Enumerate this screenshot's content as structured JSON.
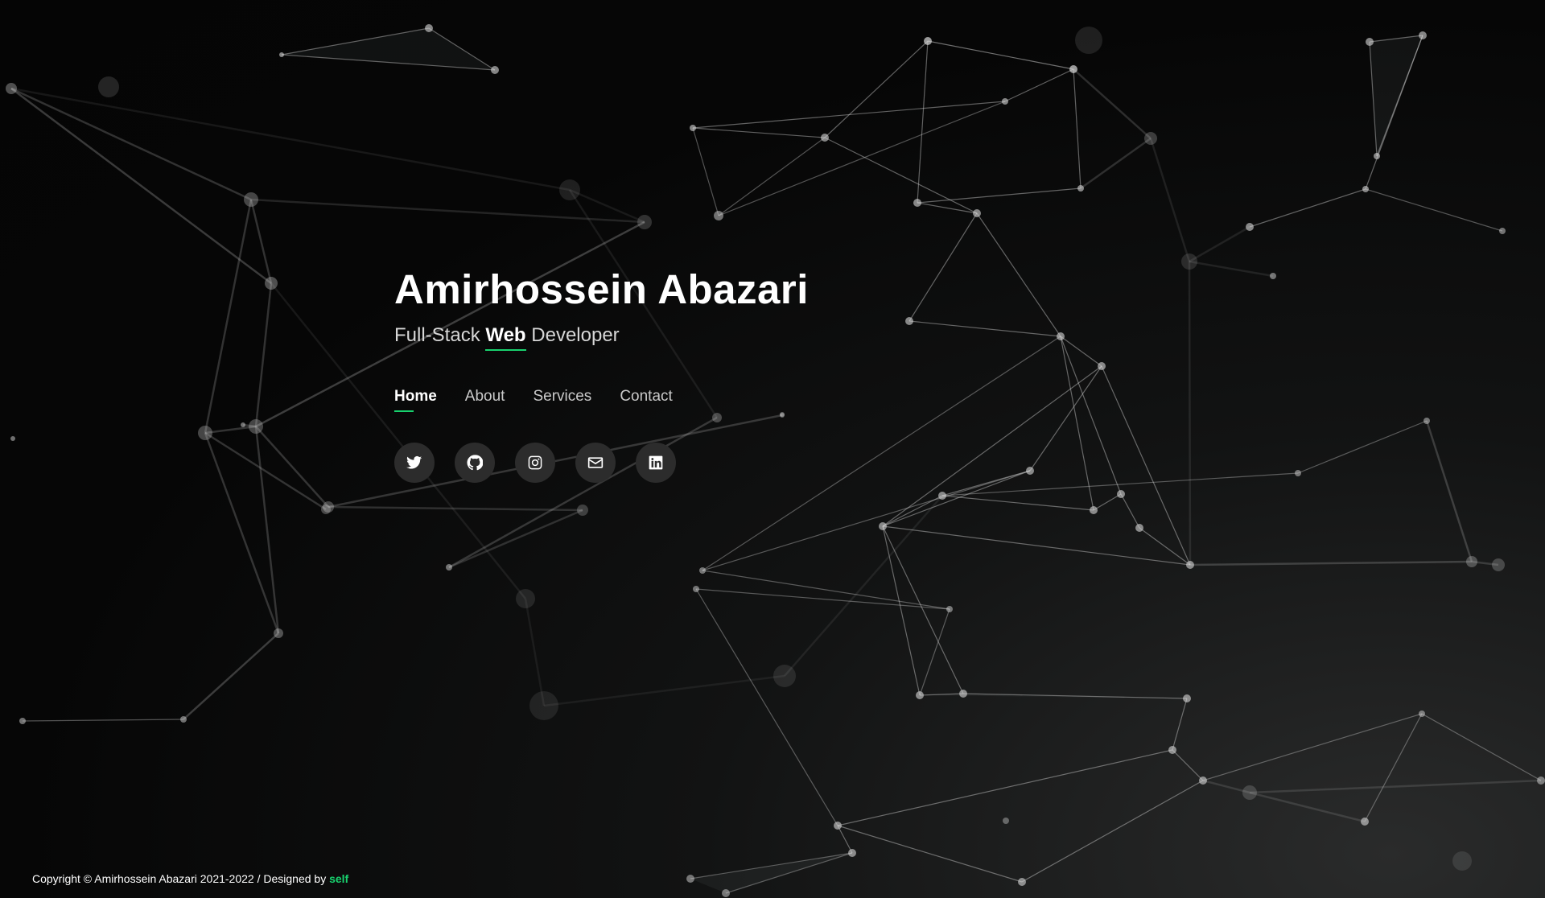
{
  "hero": {
    "name": "Amirhossein Abazari",
    "tagline_prefix": "Full-Stack ",
    "tagline_emphasis": "Web",
    "tagline_suffix": " Developer"
  },
  "nav": {
    "items": [
      {
        "label": "Home",
        "active": true
      },
      {
        "label": "About",
        "active": false
      },
      {
        "label": "Services",
        "active": false
      },
      {
        "label": "Contact",
        "active": false
      }
    ]
  },
  "socials": [
    {
      "icon": "twitter-icon"
    },
    {
      "icon": "github-icon"
    },
    {
      "icon": "instagram-icon"
    },
    {
      "icon": "envelope-icon"
    },
    {
      "icon": "linkedin-icon"
    }
  ],
  "footer": {
    "copyright": "Copyright © Amirhossein Abazari 2021-2022 / Designed by ",
    "designer": "self"
  },
  "colors": {
    "accent": "#18d26e",
    "background": "#060606",
    "social_bg": "#2c2c2c"
  }
}
